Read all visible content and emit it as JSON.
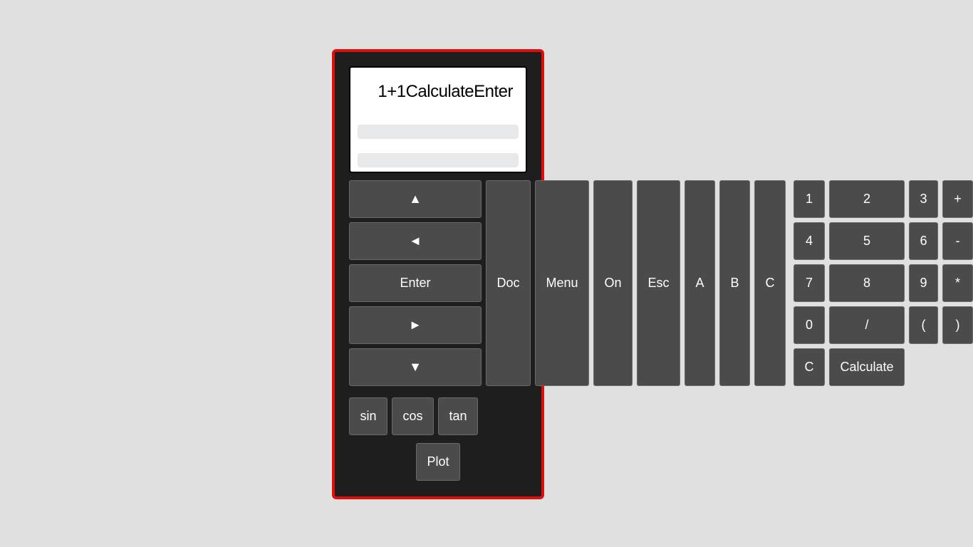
{
  "screen": {
    "expression": "1+1CalculateEnter"
  },
  "nav_keys": {
    "up": "▲",
    "left": "◄",
    "enter": "Enter",
    "right": "►",
    "down": "▼"
  },
  "function_keys": {
    "doc": "Doc",
    "menu": "Menu",
    "on": "On",
    "esc": "Esc",
    "a": "A",
    "b": "B",
    "c": "C"
  },
  "keypad": {
    "rows": [
      [
        "1",
        "2",
        "3",
        "+"
      ],
      [
        "4",
        "5",
        "6",
        "-"
      ],
      [
        "7",
        "8",
        "9",
        "*"
      ],
      [
        "0",
        "/",
        "(",
        ")"
      ]
    ],
    "clear": "C",
    "calculate": "Calculate"
  },
  "trig_keys": {
    "sin": "sin",
    "cos": "cos",
    "tan": "tan"
  },
  "plot_key": "Plot",
  "colors": {
    "background": "#e0e0e0",
    "calculator_body": "#1e1e1e",
    "calculator_border": "#e10d0d",
    "button": "#4b4b4b",
    "button_text": "#ffffff",
    "screen": "#ffffff"
  }
}
